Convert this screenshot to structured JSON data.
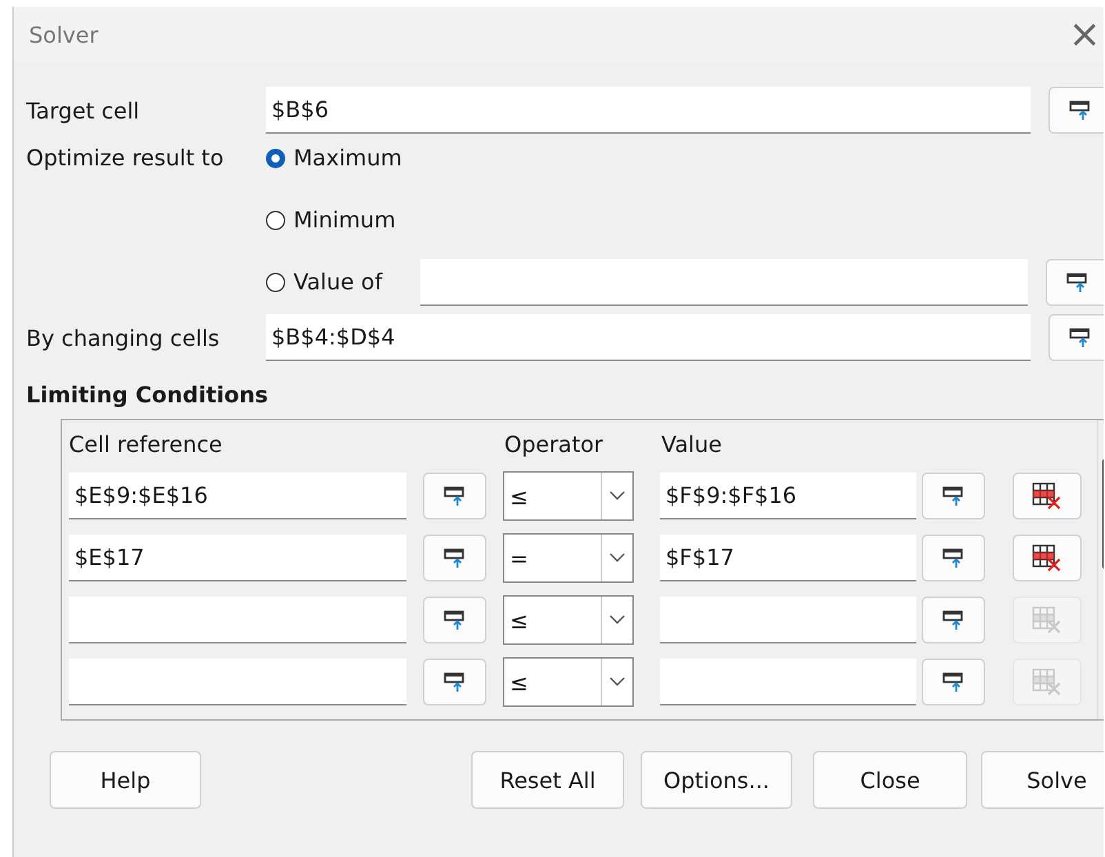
{
  "window": {
    "title": "Solver",
    "close": "×"
  },
  "target_cell": {
    "label": "Target cell",
    "value": "$B$6"
  },
  "optimize": {
    "label": "Optimize result to",
    "options": [
      {
        "label": "Maximum",
        "selected": true,
        "kind": "plain"
      },
      {
        "label": "Minimum",
        "selected": false,
        "kind": "plain"
      },
      {
        "label": "Value of",
        "selected": false,
        "kind": "field"
      }
    ]
  },
  "changing_cells": {
    "label": "By changing cells",
    "value": "$B$4:$D$4"
  },
  "limiting_conditions": {
    "title": "Limiting Conditions",
    "columns": [
      "Cell reference",
      "Operator",
      "Value"
    ],
    "rows": [
      {
        "cell_reference": "$E$9:$E$16",
        "operator": "≤",
        "value": "$F$9:$F$16",
        "delete_disabled": false
      },
      {
        "cell_reference": "$E$17",
        "operator": "=",
        "value": "$F$17",
        "delete_disabled": false
      },
      {
        "cell_reference": "",
        "operator": "≤",
        "value": "",
        "delete_disabled": true
      },
      {
        "cell_reference": "",
        "operator": "≤",
        "value": "",
        "delete_disabled": true
      }
    ]
  },
  "buttons": [
    "Help",
    "Reset All",
    "Options...",
    "Close",
    "Solve"
  ]
}
